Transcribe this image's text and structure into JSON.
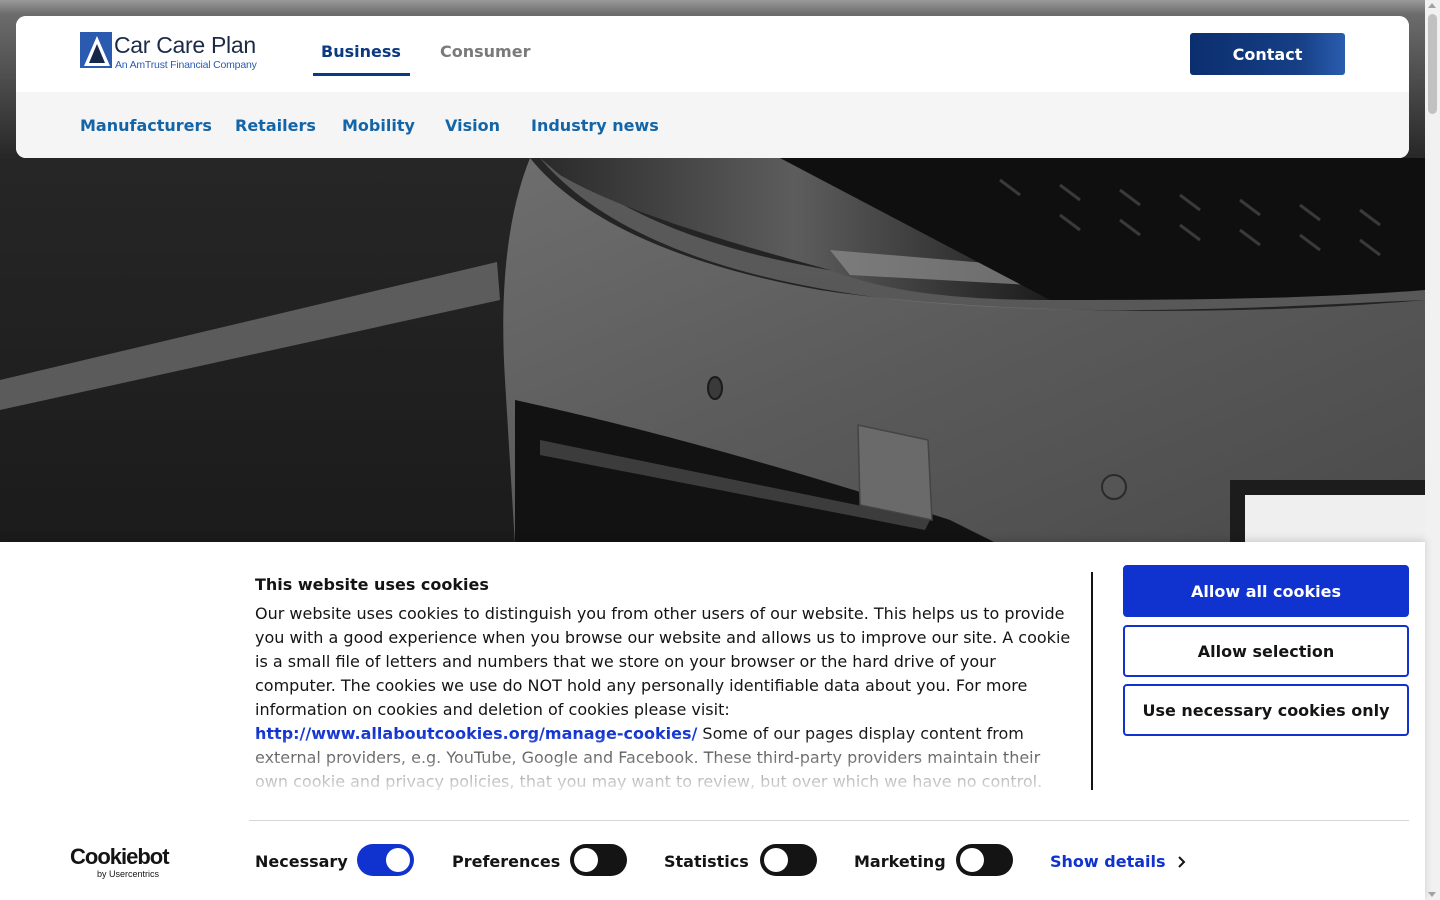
{
  "logo": {
    "name": "Car Care Plan",
    "subtitle": "An AmTrust Financial Company"
  },
  "nav": {
    "main_tabs": [
      {
        "label": "Business",
        "active": true
      },
      {
        "label": "Consumer",
        "active": false
      }
    ],
    "contact_label": "Contact",
    "sub_links": [
      "Manufacturers",
      "Retailers",
      "Mobility",
      "Vision",
      "Industry news"
    ]
  },
  "cookie_banner": {
    "title": "This website uses cookies",
    "text_before_link": "Our website uses cookies to distinguish you from other users of our website. This helps us to provide you with a good experience when you browse our website and allows us to improve our site. A cookie is a small file of letters and numbers that we store on your browser or the hard drive of your computer. The cookies we use do NOT hold any personally identifiable data about you. For more information on cookies and deletion of cookies please visit:",
    "link_text": "http://www.allaboutcookies.org/manage-cookies/",
    "text_after_link": "Some of our pages display content from external providers, e.g. YouTube, Google and Facebook. These third-party providers maintain their own cookie and privacy policies, that you may want to review, but over which we have no control.",
    "buttons": {
      "allow_all": "Allow all cookies",
      "allow_selection": "Allow selection",
      "necessary_only": "Use necessary cookies only"
    },
    "toggles": [
      {
        "label": "Necessary",
        "checked": true
      },
      {
        "label": "Preferences",
        "checked": false
      },
      {
        "label": "Statistics",
        "checked": false
      },
      {
        "label": "Marketing",
        "checked": false
      }
    ],
    "show_details": "Show details",
    "brand": {
      "name": "Cookiebot",
      "sub": "by Usercentrics"
    }
  },
  "colors": {
    "brand_navy": "#0c3a80",
    "sub_nav_blue": "#1465a8",
    "cookiebot_blue": "#1032cf"
  }
}
